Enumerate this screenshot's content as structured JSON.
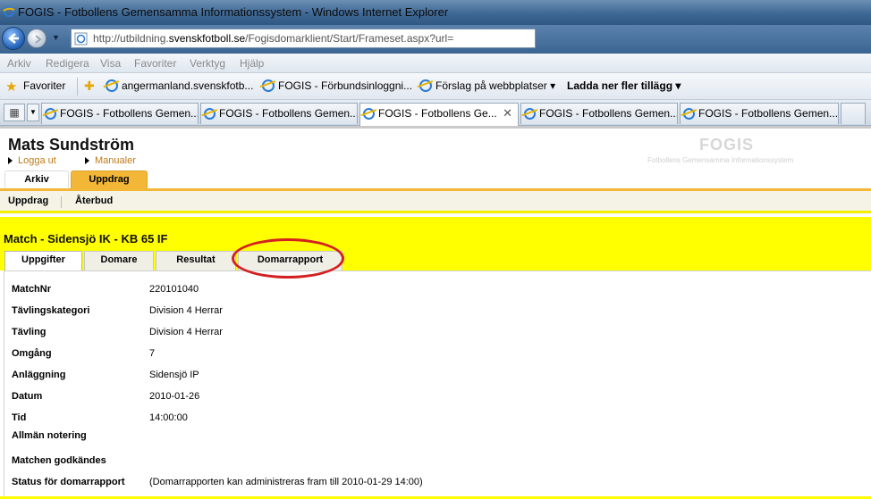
{
  "window": {
    "title": "FOGIS - Fotbollens Gemensamma Informationssystem - Windows Internet Explorer"
  },
  "address": {
    "url_prefix": "http://utbildning.",
    "url_domain": "svenskfotboll.se",
    "url_path": "/Fogisdomarklient/Start/Frameset.aspx?url="
  },
  "menu": [
    "Arkiv",
    "Redigera",
    "Visa",
    "Favoriter",
    "Verktyg",
    "Hjälp"
  ],
  "favorites_bar": {
    "favorites_label": "Favoriter",
    "items": [
      "angermanland.svenskfotb...",
      "FOGIS - Förbundsinloggni...",
      "Förslag på webbplatser ▾",
      "Ladda ner fler tillägg ▾"
    ]
  },
  "ie_tabs": [
    "FOGIS - Fotbollens Gemen...",
    "FOGIS - Fotbollens Gemen...",
    "FOGIS - Fotbollens Ge...",
    "FOGIS - Fotbollens Gemen...",
    "FOGIS - Fotbollens Gemen..."
  ],
  "header": {
    "user_name": "Mats Sundström",
    "logout": "Logga ut",
    "manuals": "Manualer",
    "brand": "FOGIS",
    "brand_sub": "Fotbollens Gemensamma Informationssystem",
    "tabs": [
      "Arkiv",
      "Uppdrag"
    ]
  },
  "subnav": [
    "Uppdrag",
    "Återbud"
  ],
  "match": {
    "title": "Match - Sidensjö IK - KB 65 IF",
    "tabs": [
      "Uppgifter",
      "Domare",
      "Resultat",
      "Domarrapport"
    ],
    "fields": [
      {
        "label": "MatchNr",
        "value": "220101040"
      },
      {
        "label": "Tävlingskategori",
        "value": "Division 4 Herrar"
      },
      {
        "label": "Tävling",
        "value": "Division 4 Herrar"
      },
      {
        "label": "Omgång",
        "value": "7"
      },
      {
        "label": "Anläggning",
        "value": "Sidensjö IP"
      },
      {
        "label": "Datum",
        "value": "2010-01-26"
      },
      {
        "label": "Tid",
        "value": "14:00:00"
      },
      {
        "label": "Allmän notering",
        "value": ""
      },
      {
        "label": "Matchen godkändes",
        "value": ""
      },
      {
        "label": "Status för domarrapport",
        "value": "(Domarrapporten kan administreras fram till 2010-01-29 14:00)"
      }
    ]
  },
  "colors": {
    "accent_yellow": "#ffff00",
    "tab_orange": "#f2b737",
    "highlight_red": "#d42020"
  }
}
